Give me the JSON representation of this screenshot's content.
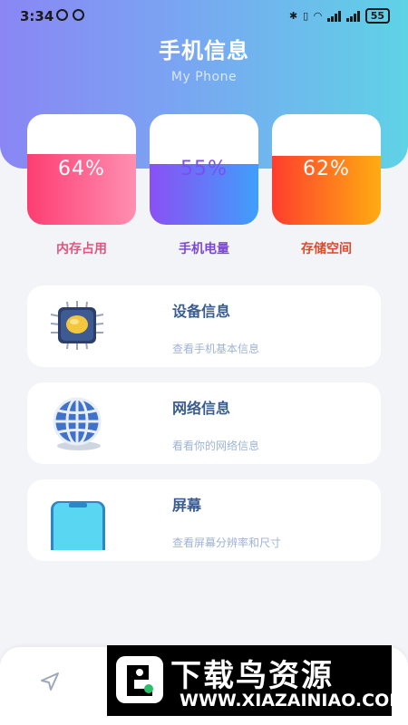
{
  "status_bar": {
    "time": "3:34",
    "battery": "55"
  },
  "header": {
    "title": "手机信息",
    "subtitle": "My Phone"
  },
  "stats": [
    {
      "value": "64%",
      "label": "内存占用",
      "level": 0.64,
      "gradient": [
        "#fd3d72",
        "#ff8fb1"
      ],
      "value_color": "#ffffff",
      "label_color": "#e2557e"
    },
    {
      "value": "55%",
      "label": "手机电量",
      "level": 0.55,
      "gradient": [
        "#8a50f4",
        "#3f9ffb"
      ],
      "value_color": "#7c4ff2",
      "label_color": "#7b47d9"
    },
    {
      "value": "62%",
      "label": "存储空间",
      "level": 0.62,
      "gradient": [
        "#ff3d2e",
        "#ffac12"
      ],
      "value_color": "#ffffff",
      "label_color": "#e0482a"
    }
  ],
  "features": [
    {
      "title": "设备信息",
      "desc": "查看手机基本信息",
      "icon": "chip-icon"
    },
    {
      "title": "网络信息",
      "desc": "看看你的网络信息",
      "icon": "globe-icon"
    },
    {
      "title": "屏幕",
      "desc": "查看屏幕分辨率和尺寸",
      "icon": "phone-screen-icon"
    }
  ],
  "nav": {
    "icon": "send-icon"
  },
  "watermark": {
    "title": "下载鸟资源",
    "url": "WWW.XIAZAINIAO.COM"
  },
  "colors": {
    "accent": "#79a6f2",
    "title_blue": "#3a5d8f",
    "desc_blue": "#9fb4d1"
  }
}
